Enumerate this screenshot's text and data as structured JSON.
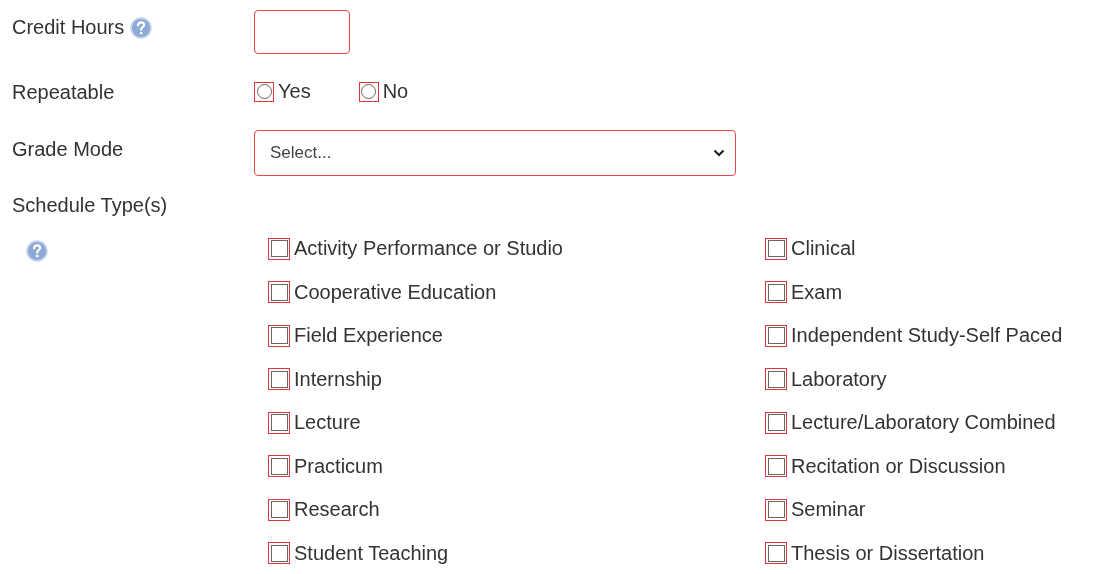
{
  "credit_hours": {
    "label": "Credit Hours"
  },
  "repeatable": {
    "label": "Repeatable",
    "options": [
      {
        "label": "Yes",
        "selected": false
      },
      {
        "label": "No",
        "selected": false
      }
    ]
  },
  "grade_mode": {
    "label": "Grade Mode",
    "placeholder": "Select..."
  },
  "schedule_types": {
    "label": "Schedule Type(s)",
    "options": [
      {
        "label": "Activity Performance or Studio",
        "checked": false
      },
      {
        "label": "Clinical",
        "checked": false
      },
      {
        "label": "Cooperative Education",
        "checked": false
      },
      {
        "label": "Exam",
        "checked": false
      },
      {
        "label": "Field Experience",
        "checked": false
      },
      {
        "label": "Independent Study-Self Paced",
        "checked": false
      },
      {
        "label": "Internship",
        "checked": false
      },
      {
        "label": "Laboratory",
        "checked": false
      },
      {
        "label": "Lecture",
        "checked": false
      },
      {
        "label": "Lecture/Laboratory Combined",
        "checked": false
      },
      {
        "label": "Practicum",
        "checked": false
      },
      {
        "label": "Recitation or Discussion",
        "checked": false
      },
      {
        "label": "Research",
        "checked": false
      },
      {
        "label": "Seminar",
        "checked": false
      },
      {
        "label": "Student Teaching",
        "checked": false
      },
      {
        "label": "Thesis or Dissertation",
        "checked": false
      }
    ]
  }
}
